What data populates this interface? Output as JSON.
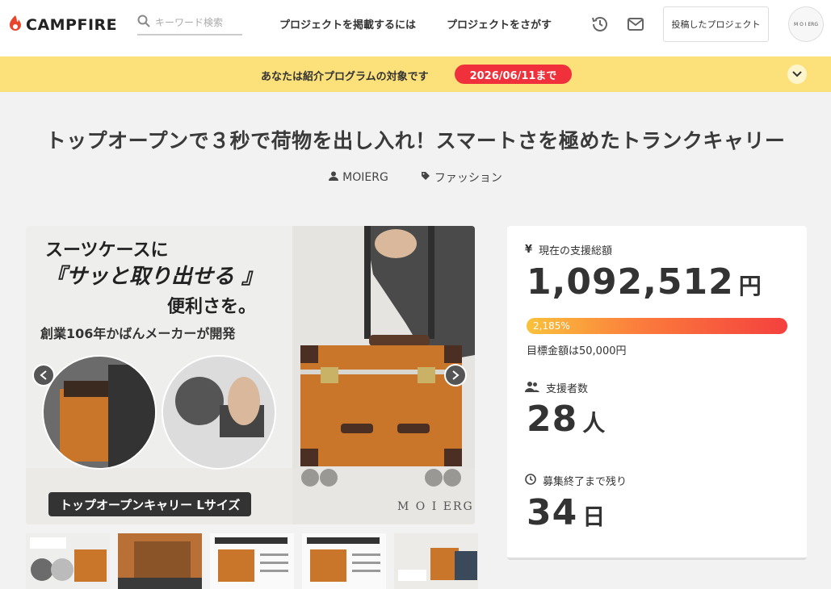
{
  "header": {
    "logo_text": "CAMPFIRE",
    "search_placeholder": "キーワード検索",
    "nav": [
      "プロジェクトを掲載するには",
      "プロジェクトをさがす"
    ],
    "posted_button": "投稿したプロジェクト",
    "avatar_text": "M O I ERG"
  },
  "banner": {
    "text": "あなたは紹介プログラムの対象です",
    "badge": "2026/06/11まで"
  },
  "project": {
    "title": "トップオープンで３秒で荷物を出し入れ！スマートさを極めたトランクキャリー",
    "owner": "MOIERG",
    "category": "ファッション"
  },
  "main_image": {
    "line1": "スーツケースに",
    "line2": "『サッと取り出せる 』",
    "line3": "便利さを。",
    "line4": "創業106年かばんメーカーが開発",
    "caption": "トップオープンキャリー Lサイズ",
    "brand": "M O I  ERG"
  },
  "stats": {
    "total_label": "現在の支援総額",
    "total_amount": "1,092,512",
    "total_unit": "円",
    "progress_text": "2,185%",
    "progress_percent": 2185,
    "goal_text": "目標金額は50,000円",
    "supporters_label": "支援者数",
    "supporters_count": "28",
    "supporters_unit": "人",
    "remaining_label": "募集終了まで残り",
    "remaining_count": "34",
    "remaining_unit": "日"
  },
  "colors": {
    "accent_red": "#f0303a",
    "banner_yellow": "#fce07a",
    "logo_red": "#e8452c",
    "trunk_orange": "#c9752a"
  }
}
